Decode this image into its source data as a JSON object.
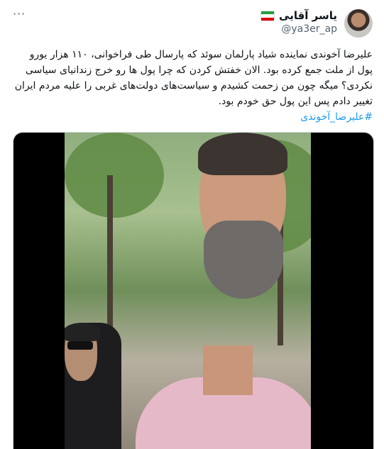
{
  "tweet": {
    "more_label": "···",
    "author": {
      "display_name": "یاسر آقایی",
      "handle": "@ya3er_ap",
      "flag_colors": [
        "#239f40",
        "#ffffff",
        "#da0000"
      ]
    },
    "text": "علیرضا آخوندی نماینده شیاد پارلمان سوئد که پارسال طی فراخوانی، ۱۱۰ هزار یورو پول از ملت جمع کرده بود. الان خفتش کردن که چرا پول ها رو خرج زندانیای سیاسی نکردی؟ میگه چون من زحمت کشیدم و سیاست‌های دولت‌های غربی را علیه مردم ایران تغییر دادم پس این پول حق خودم بود.",
    "hashtag": "#علیرضا_آخوندی"
  },
  "colors": {
    "link": "#1d9bf0",
    "muted": "#536471"
  }
}
